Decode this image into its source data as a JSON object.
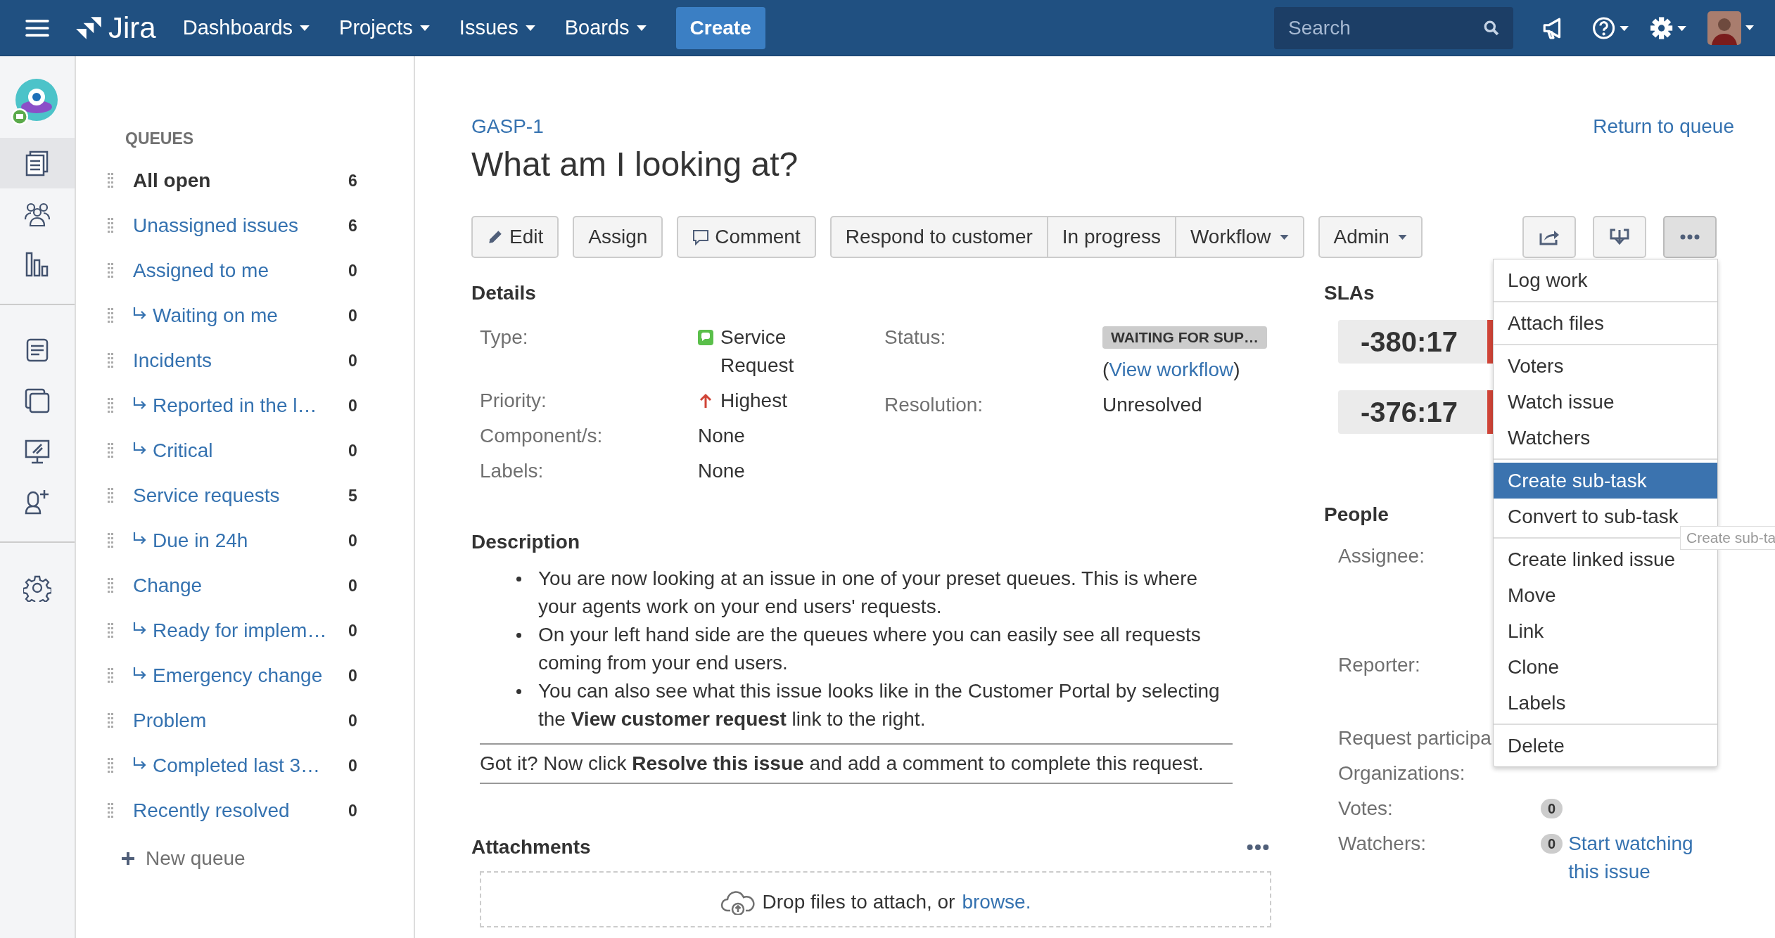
{
  "topbar": {
    "logo": "Jira",
    "nav": [
      {
        "label": "Dashboards"
      },
      {
        "label": "Projects"
      },
      {
        "label": "Issues"
      },
      {
        "label": "Boards"
      }
    ],
    "create": "Create",
    "search": {
      "placeholder": "Search"
    }
  },
  "rail": [
    {
      "kind": "queues",
      "selected": true
    },
    {
      "kind": "customers",
      "selected": false
    },
    {
      "kind": "reports",
      "selected": false
    },
    {
      "kind": "knowledge",
      "selected": false
    },
    {
      "kind": "channels",
      "selected": false
    },
    {
      "kind": "monitor",
      "selected": false
    },
    {
      "kind": "invite",
      "selected": false
    },
    {
      "kind": "settings",
      "selected": false
    }
  ],
  "queues": {
    "heading": "QUEUES",
    "items": [
      {
        "label": "All open",
        "count": "6",
        "selected": true
      },
      {
        "label": "Unassigned issues",
        "count": "6",
        "selected": false
      },
      {
        "label": "Assigned to me",
        "count": "0",
        "selected": false,
        "children": [
          {
            "label": "Waiting on me",
            "count": "0",
            "selected": false
          }
        ]
      },
      {
        "label": "Incidents",
        "count": "0",
        "selected": false,
        "children": [
          {
            "label": "Reported in the l…",
            "count": "0",
            "selected": false
          },
          {
            "label": "Critical",
            "count": "0",
            "selected": false
          }
        ]
      },
      {
        "label": "Service requests",
        "count": "5",
        "selected": false,
        "children": [
          {
            "label": "Due in 24h",
            "count": "0",
            "selected": false
          }
        ]
      },
      {
        "label": "Change",
        "count": "0",
        "selected": false,
        "children": [
          {
            "label": "Ready for implem…",
            "count": "0",
            "selected": false
          },
          {
            "label": "Emergency change",
            "count": "0",
            "selected": false
          }
        ]
      },
      {
        "label": "Problem",
        "count": "0",
        "selected": false,
        "children": [
          {
            "label": "Completed last 3…",
            "count": "0",
            "selected": false
          }
        ]
      },
      {
        "label": "Recently resolved",
        "count": "0",
        "selected": false
      }
    ],
    "new_queue": "New queue"
  },
  "issue": {
    "key": "GASP-1",
    "title": "What am I looking at?",
    "return_link": "Return to queue"
  },
  "toolbar": {
    "groups": [
      [
        {
          "label": "Edit",
          "kind": "edit",
          "caret": false
        }
      ],
      [
        {
          "label": "Assign",
          "kind": "plain",
          "caret": false
        }
      ],
      [
        {
          "label": "Comment",
          "kind": "comment",
          "caret": false
        }
      ],
      [
        {
          "label": "Respond to customer",
          "kind": "plain",
          "caret": false
        },
        {
          "label": "In progress",
          "kind": "plain",
          "caret": false
        },
        {
          "label": "Workflow",
          "kind": "plain",
          "caret": true
        }
      ],
      [
        {
          "label": "Admin",
          "kind": "plain",
          "caret": true
        }
      ]
    ],
    "icon_buttons": [
      {
        "kind": "share",
        "selected": false
      },
      {
        "kind": "export",
        "selected": false
      },
      {
        "kind": "more",
        "selected": true
      }
    ]
  },
  "details": {
    "heading": "Details",
    "left": [
      {
        "label": "Type:",
        "value": "Service Request",
        "kind": "type"
      },
      {
        "label": "Priority:",
        "value": "Highest",
        "kind": "priority"
      },
      {
        "label": "Component/s:",
        "value": "None",
        "kind": "text"
      },
      {
        "label": "Labels:",
        "value": "None",
        "kind": "text"
      }
    ],
    "status": {
      "label": "Status:",
      "value": "WAITING FOR SUP…",
      "link_prefix": "(",
      "link": "View workflow",
      "link_suffix": ")"
    },
    "resolution": {
      "label": "Resolution:",
      "value": "Unresolved"
    }
  },
  "description": {
    "heading": "Description",
    "bullets": [
      "You are now looking at an issue in one of your preset queues. This is where your agents work on your end users' requests.",
      "On your left hand side are the queues where you can easily see all requests coming from your end users.",
      "You can also see what this issue looks like in the Customer Portal by selecting the **View customer request** link to the right."
    ],
    "note": "Got it? Now click **Resolve this issue** and add a comment to complete this request."
  },
  "attachments": {
    "heading": "Attachments",
    "drop_text": "Drop files to attach, or",
    "browse": "browse."
  },
  "slas": {
    "heading": "SLAs",
    "timers": [
      "-380:17",
      "-376:17"
    ]
  },
  "people": {
    "heading": "People",
    "fields": [
      {
        "label": "Assignee:",
        "kind": "empty"
      },
      {
        "label": "Reporter:",
        "kind": "empty"
      },
      {
        "label": "Request participa",
        "kind": "empty"
      },
      {
        "label": "Organizations:",
        "kind": "empty"
      },
      {
        "label": "Votes:",
        "kind": "count",
        "count": "0"
      },
      {
        "label": "Watchers:",
        "kind": "count",
        "count": "0",
        "link": "Start watching this issue"
      }
    ]
  },
  "menu": {
    "sections": [
      [
        {
          "label": "Log work",
          "selected": false
        }
      ],
      [
        {
          "label": "Attach files",
          "selected": false
        }
      ],
      [
        {
          "label": "Voters",
          "selected": false
        },
        {
          "label": "Watch issue",
          "selected": false
        },
        {
          "label": "Watchers",
          "selected": false
        }
      ],
      [
        {
          "label": "Create sub-task",
          "selected": true
        },
        {
          "label": "Convert to sub-task",
          "selected": false
        }
      ],
      [
        {
          "label": "Create linked issue",
          "selected": false
        },
        {
          "label": "Move",
          "selected": false
        },
        {
          "label": "Link",
          "selected": false
        },
        {
          "label": "Clone",
          "selected": false
        },
        {
          "label": "Labels",
          "selected": false
        }
      ],
      [
        {
          "label": "Delete",
          "selected": false
        }
      ]
    ]
  },
  "tooltip": "Create sub-ta"
}
